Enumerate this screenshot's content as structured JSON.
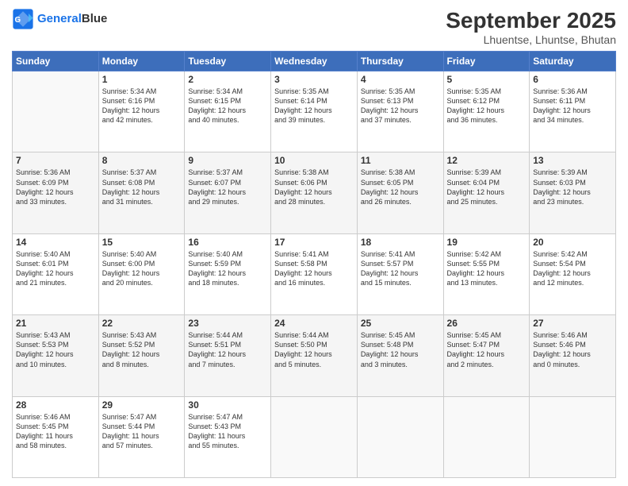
{
  "header": {
    "logo_line1": "General",
    "logo_line2": "Blue",
    "title": "September 2025",
    "subtitle": "Lhuentse, Lhuntse, Bhutan"
  },
  "weekdays": [
    "Sunday",
    "Monday",
    "Tuesday",
    "Wednesday",
    "Thursday",
    "Friday",
    "Saturday"
  ],
  "weeks": [
    [
      {
        "day": "",
        "info": ""
      },
      {
        "day": "1",
        "info": "Sunrise: 5:34 AM\nSunset: 6:16 PM\nDaylight: 12 hours\nand 42 minutes."
      },
      {
        "day": "2",
        "info": "Sunrise: 5:34 AM\nSunset: 6:15 PM\nDaylight: 12 hours\nand 40 minutes."
      },
      {
        "day": "3",
        "info": "Sunrise: 5:35 AM\nSunset: 6:14 PM\nDaylight: 12 hours\nand 39 minutes."
      },
      {
        "day": "4",
        "info": "Sunrise: 5:35 AM\nSunset: 6:13 PM\nDaylight: 12 hours\nand 37 minutes."
      },
      {
        "day": "5",
        "info": "Sunrise: 5:35 AM\nSunset: 6:12 PM\nDaylight: 12 hours\nand 36 minutes."
      },
      {
        "day": "6",
        "info": "Sunrise: 5:36 AM\nSunset: 6:11 PM\nDaylight: 12 hours\nand 34 minutes."
      }
    ],
    [
      {
        "day": "7",
        "info": "Sunrise: 5:36 AM\nSunset: 6:09 PM\nDaylight: 12 hours\nand 33 minutes."
      },
      {
        "day": "8",
        "info": "Sunrise: 5:37 AM\nSunset: 6:08 PM\nDaylight: 12 hours\nand 31 minutes."
      },
      {
        "day": "9",
        "info": "Sunrise: 5:37 AM\nSunset: 6:07 PM\nDaylight: 12 hours\nand 29 minutes."
      },
      {
        "day": "10",
        "info": "Sunrise: 5:38 AM\nSunset: 6:06 PM\nDaylight: 12 hours\nand 28 minutes."
      },
      {
        "day": "11",
        "info": "Sunrise: 5:38 AM\nSunset: 6:05 PM\nDaylight: 12 hours\nand 26 minutes."
      },
      {
        "day": "12",
        "info": "Sunrise: 5:39 AM\nSunset: 6:04 PM\nDaylight: 12 hours\nand 25 minutes."
      },
      {
        "day": "13",
        "info": "Sunrise: 5:39 AM\nSunset: 6:03 PM\nDaylight: 12 hours\nand 23 minutes."
      }
    ],
    [
      {
        "day": "14",
        "info": "Sunrise: 5:40 AM\nSunset: 6:01 PM\nDaylight: 12 hours\nand 21 minutes."
      },
      {
        "day": "15",
        "info": "Sunrise: 5:40 AM\nSunset: 6:00 PM\nDaylight: 12 hours\nand 20 minutes."
      },
      {
        "day": "16",
        "info": "Sunrise: 5:40 AM\nSunset: 5:59 PM\nDaylight: 12 hours\nand 18 minutes."
      },
      {
        "day": "17",
        "info": "Sunrise: 5:41 AM\nSunset: 5:58 PM\nDaylight: 12 hours\nand 16 minutes."
      },
      {
        "day": "18",
        "info": "Sunrise: 5:41 AM\nSunset: 5:57 PM\nDaylight: 12 hours\nand 15 minutes."
      },
      {
        "day": "19",
        "info": "Sunrise: 5:42 AM\nSunset: 5:55 PM\nDaylight: 12 hours\nand 13 minutes."
      },
      {
        "day": "20",
        "info": "Sunrise: 5:42 AM\nSunset: 5:54 PM\nDaylight: 12 hours\nand 12 minutes."
      }
    ],
    [
      {
        "day": "21",
        "info": "Sunrise: 5:43 AM\nSunset: 5:53 PM\nDaylight: 12 hours\nand 10 minutes."
      },
      {
        "day": "22",
        "info": "Sunrise: 5:43 AM\nSunset: 5:52 PM\nDaylight: 12 hours\nand 8 minutes."
      },
      {
        "day": "23",
        "info": "Sunrise: 5:44 AM\nSunset: 5:51 PM\nDaylight: 12 hours\nand 7 minutes."
      },
      {
        "day": "24",
        "info": "Sunrise: 5:44 AM\nSunset: 5:50 PM\nDaylight: 12 hours\nand 5 minutes."
      },
      {
        "day": "25",
        "info": "Sunrise: 5:45 AM\nSunset: 5:48 PM\nDaylight: 12 hours\nand 3 minutes."
      },
      {
        "day": "26",
        "info": "Sunrise: 5:45 AM\nSunset: 5:47 PM\nDaylight: 12 hours\nand 2 minutes."
      },
      {
        "day": "27",
        "info": "Sunrise: 5:46 AM\nSunset: 5:46 PM\nDaylight: 12 hours\nand 0 minutes."
      }
    ],
    [
      {
        "day": "28",
        "info": "Sunrise: 5:46 AM\nSunset: 5:45 PM\nDaylight: 11 hours\nand 58 minutes."
      },
      {
        "day": "29",
        "info": "Sunrise: 5:47 AM\nSunset: 5:44 PM\nDaylight: 11 hours\nand 57 minutes."
      },
      {
        "day": "30",
        "info": "Sunrise: 5:47 AM\nSunset: 5:43 PM\nDaylight: 11 hours\nand 55 minutes."
      },
      {
        "day": "",
        "info": ""
      },
      {
        "day": "",
        "info": ""
      },
      {
        "day": "",
        "info": ""
      },
      {
        "day": "",
        "info": ""
      }
    ]
  ]
}
